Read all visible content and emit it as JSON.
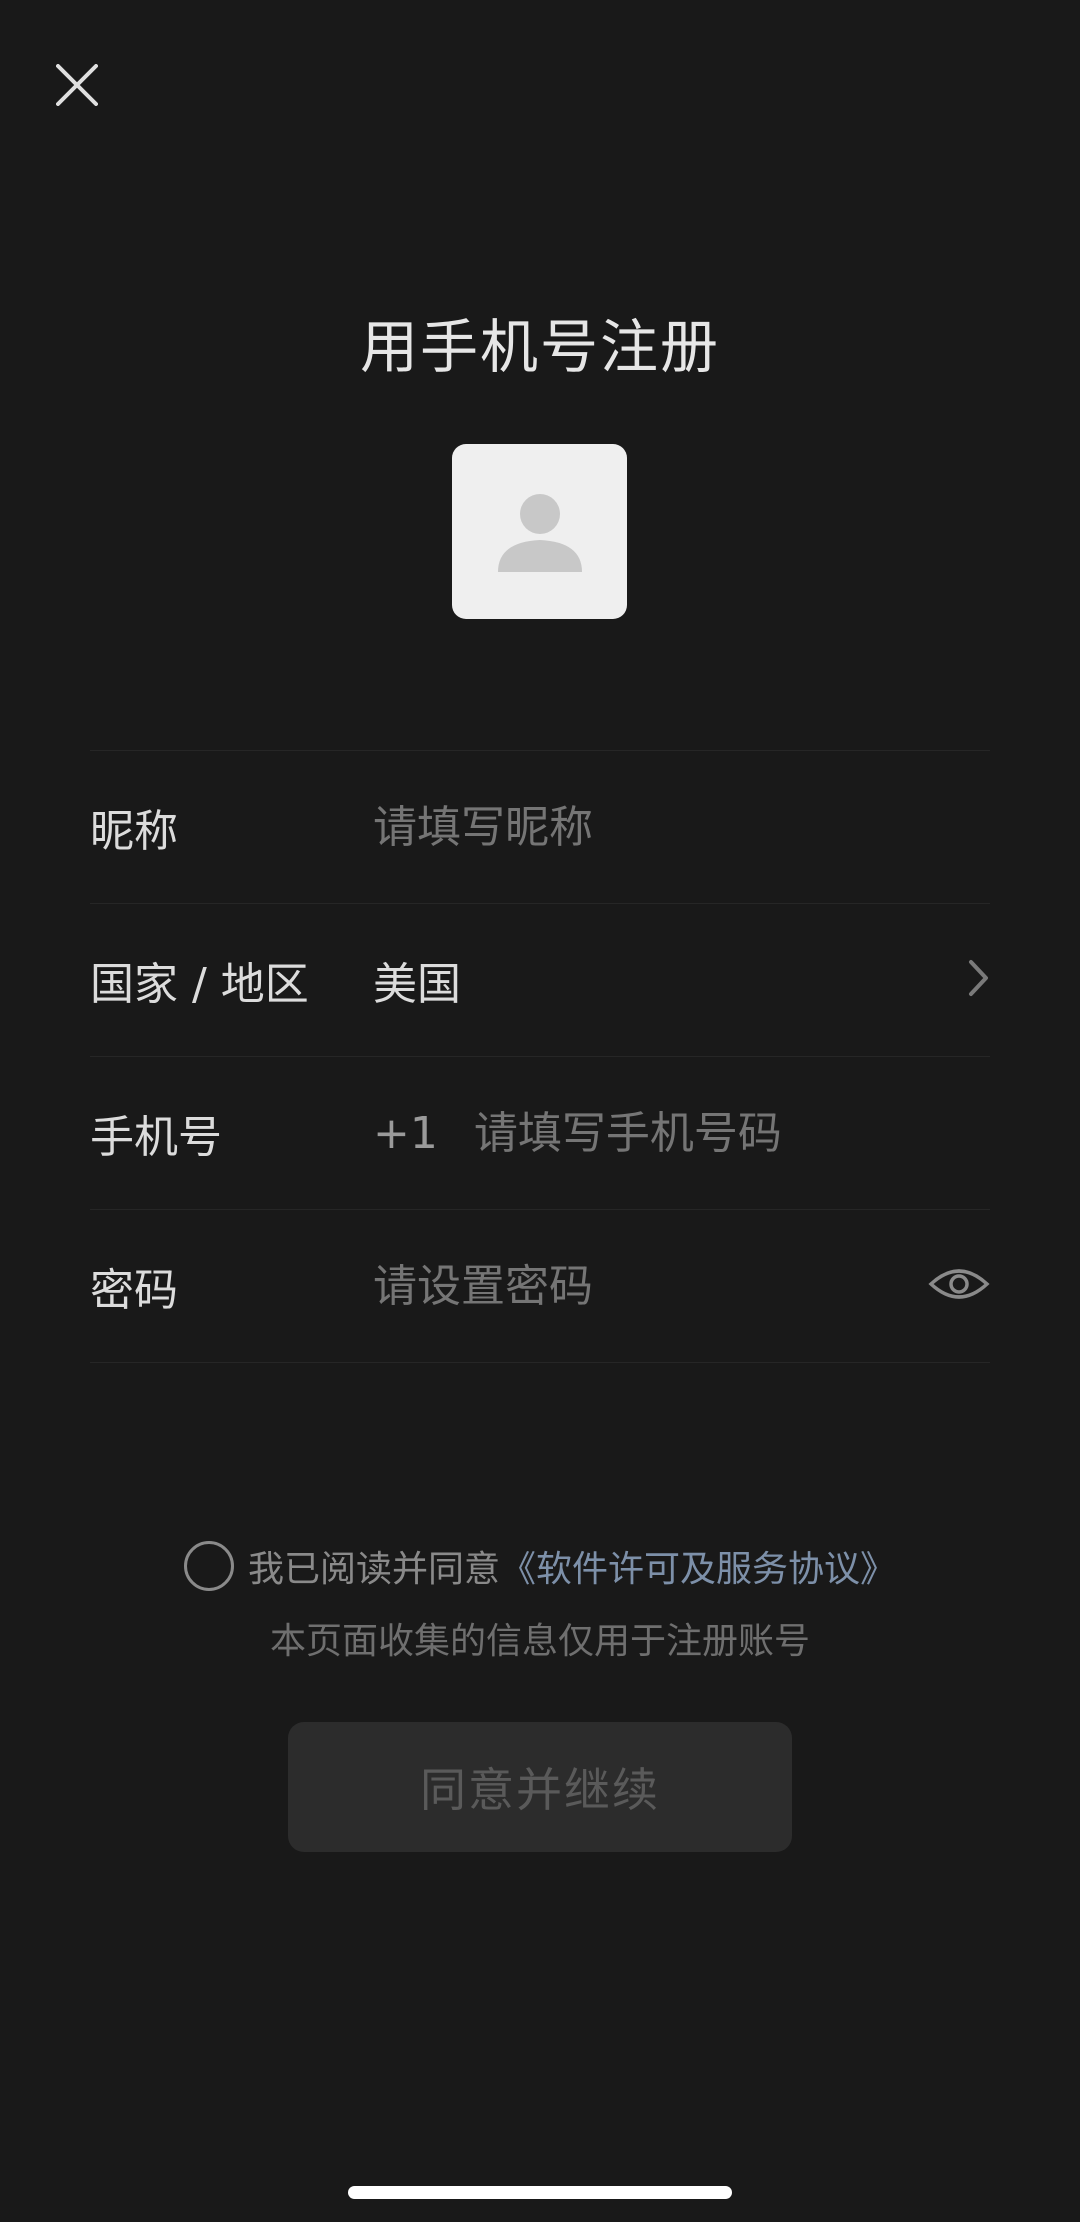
{
  "header": {
    "title": "用手机号注册"
  },
  "icons": {
    "close": "close-icon",
    "avatar": "person-icon",
    "chevron": "chevron-right-icon",
    "eye": "eye-icon"
  },
  "form": {
    "nickname": {
      "label": "昵称",
      "placeholder": "请填写昵称"
    },
    "region": {
      "label": "国家 / 地区",
      "value": "美国"
    },
    "phone": {
      "label": "手机号",
      "prefix": "+1",
      "placeholder": "请填写手机号码"
    },
    "password": {
      "label": "密码",
      "placeholder": "请设置密码"
    }
  },
  "agreement": {
    "prefix": "我已阅读并同意",
    "link": "《软件许可及服务协议》",
    "note": "本页面收集的信息仅用于注册账号"
  },
  "button": {
    "label": "同意并继续"
  },
  "colors": {
    "background": "#191919",
    "link": "#7d90a9",
    "button_bg": "#2c2c2c"
  }
}
